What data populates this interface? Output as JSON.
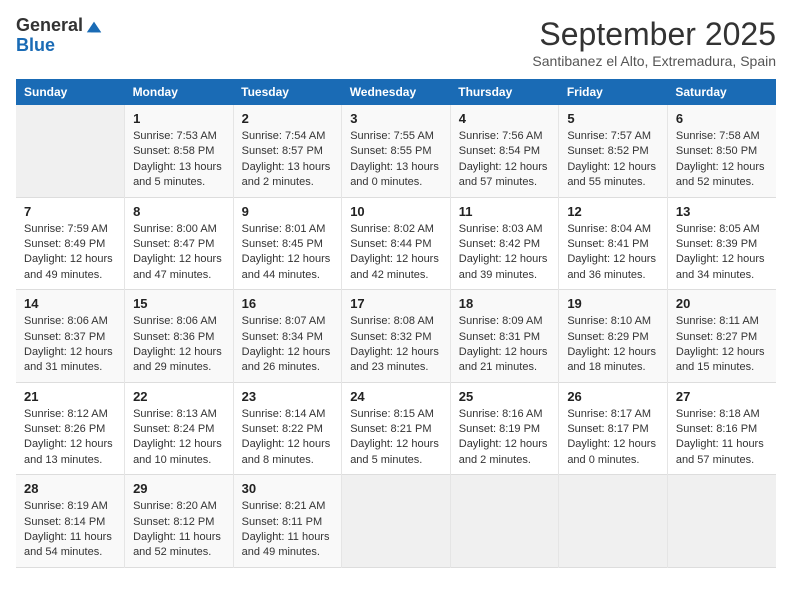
{
  "logo": {
    "general": "General",
    "blue": "Blue"
  },
  "header": {
    "month": "September 2025",
    "location": "Santibanez el Alto, Extremadura, Spain"
  },
  "weekdays": [
    "Sunday",
    "Monday",
    "Tuesday",
    "Wednesday",
    "Thursday",
    "Friday",
    "Saturday"
  ],
  "weeks": [
    [
      {
        "day": "",
        "info": ""
      },
      {
        "day": "1",
        "info": "Sunrise: 7:53 AM\nSunset: 8:58 PM\nDaylight: 13 hours\nand 5 minutes."
      },
      {
        "day": "2",
        "info": "Sunrise: 7:54 AM\nSunset: 8:57 PM\nDaylight: 13 hours\nand 2 minutes."
      },
      {
        "day": "3",
        "info": "Sunrise: 7:55 AM\nSunset: 8:55 PM\nDaylight: 13 hours\nand 0 minutes."
      },
      {
        "day": "4",
        "info": "Sunrise: 7:56 AM\nSunset: 8:54 PM\nDaylight: 12 hours\nand 57 minutes."
      },
      {
        "day": "5",
        "info": "Sunrise: 7:57 AM\nSunset: 8:52 PM\nDaylight: 12 hours\nand 55 minutes."
      },
      {
        "day": "6",
        "info": "Sunrise: 7:58 AM\nSunset: 8:50 PM\nDaylight: 12 hours\nand 52 minutes."
      }
    ],
    [
      {
        "day": "7",
        "info": "Sunrise: 7:59 AM\nSunset: 8:49 PM\nDaylight: 12 hours\nand 49 minutes."
      },
      {
        "day": "8",
        "info": "Sunrise: 8:00 AM\nSunset: 8:47 PM\nDaylight: 12 hours\nand 47 minutes."
      },
      {
        "day": "9",
        "info": "Sunrise: 8:01 AM\nSunset: 8:45 PM\nDaylight: 12 hours\nand 44 minutes."
      },
      {
        "day": "10",
        "info": "Sunrise: 8:02 AM\nSunset: 8:44 PM\nDaylight: 12 hours\nand 42 minutes."
      },
      {
        "day": "11",
        "info": "Sunrise: 8:03 AM\nSunset: 8:42 PM\nDaylight: 12 hours\nand 39 minutes."
      },
      {
        "day": "12",
        "info": "Sunrise: 8:04 AM\nSunset: 8:41 PM\nDaylight: 12 hours\nand 36 minutes."
      },
      {
        "day": "13",
        "info": "Sunrise: 8:05 AM\nSunset: 8:39 PM\nDaylight: 12 hours\nand 34 minutes."
      }
    ],
    [
      {
        "day": "14",
        "info": "Sunrise: 8:06 AM\nSunset: 8:37 PM\nDaylight: 12 hours\nand 31 minutes."
      },
      {
        "day": "15",
        "info": "Sunrise: 8:06 AM\nSunset: 8:36 PM\nDaylight: 12 hours\nand 29 minutes."
      },
      {
        "day": "16",
        "info": "Sunrise: 8:07 AM\nSunset: 8:34 PM\nDaylight: 12 hours\nand 26 minutes."
      },
      {
        "day": "17",
        "info": "Sunrise: 8:08 AM\nSunset: 8:32 PM\nDaylight: 12 hours\nand 23 minutes."
      },
      {
        "day": "18",
        "info": "Sunrise: 8:09 AM\nSunset: 8:31 PM\nDaylight: 12 hours\nand 21 minutes."
      },
      {
        "day": "19",
        "info": "Sunrise: 8:10 AM\nSunset: 8:29 PM\nDaylight: 12 hours\nand 18 minutes."
      },
      {
        "day": "20",
        "info": "Sunrise: 8:11 AM\nSunset: 8:27 PM\nDaylight: 12 hours\nand 15 minutes."
      }
    ],
    [
      {
        "day": "21",
        "info": "Sunrise: 8:12 AM\nSunset: 8:26 PM\nDaylight: 12 hours\nand 13 minutes."
      },
      {
        "day": "22",
        "info": "Sunrise: 8:13 AM\nSunset: 8:24 PM\nDaylight: 12 hours\nand 10 minutes."
      },
      {
        "day": "23",
        "info": "Sunrise: 8:14 AM\nSunset: 8:22 PM\nDaylight: 12 hours\nand 8 minutes."
      },
      {
        "day": "24",
        "info": "Sunrise: 8:15 AM\nSunset: 8:21 PM\nDaylight: 12 hours\nand 5 minutes."
      },
      {
        "day": "25",
        "info": "Sunrise: 8:16 AM\nSunset: 8:19 PM\nDaylight: 12 hours\nand 2 minutes."
      },
      {
        "day": "26",
        "info": "Sunrise: 8:17 AM\nSunset: 8:17 PM\nDaylight: 12 hours\nand 0 minutes."
      },
      {
        "day": "27",
        "info": "Sunrise: 8:18 AM\nSunset: 8:16 PM\nDaylight: 11 hours\nand 57 minutes."
      }
    ],
    [
      {
        "day": "28",
        "info": "Sunrise: 8:19 AM\nSunset: 8:14 PM\nDaylight: 11 hours\nand 54 minutes."
      },
      {
        "day": "29",
        "info": "Sunrise: 8:20 AM\nSunset: 8:12 PM\nDaylight: 11 hours\nand 52 minutes."
      },
      {
        "day": "30",
        "info": "Sunrise: 8:21 AM\nSunset: 8:11 PM\nDaylight: 11 hours\nand 49 minutes."
      },
      {
        "day": "",
        "info": ""
      },
      {
        "day": "",
        "info": ""
      },
      {
        "day": "",
        "info": ""
      },
      {
        "day": "",
        "info": ""
      }
    ]
  ]
}
